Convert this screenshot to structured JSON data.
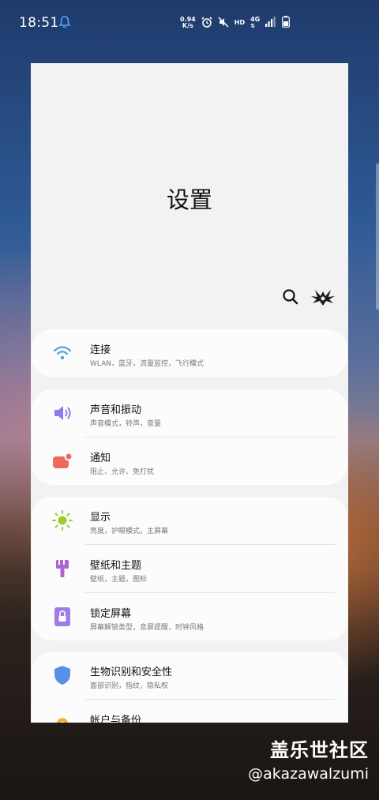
{
  "status": {
    "time": "18:51",
    "speed_value": "0.94",
    "speed_unit": "K/s",
    "hd": "HD",
    "net": "4G"
  },
  "settings": {
    "title": "设置",
    "groups": [
      {
        "items": [
          {
            "label": "连接",
            "sub": "WLAN，蓝牙，流量监控，飞行模式",
            "icon": "wifi-icon"
          }
        ]
      },
      {
        "items": [
          {
            "label": "声音和振动",
            "sub": "声音模式，铃声，音量",
            "icon": "speaker-icon"
          },
          {
            "label": "通知",
            "sub": "阻止、允许、免打扰",
            "icon": "notification-icon"
          }
        ]
      },
      {
        "items": [
          {
            "label": "显示",
            "sub": "亮度，护眼模式，主屏幕",
            "icon": "brightness-icon"
          },
          {
            "label": "壁纸和主题",
            "sub": "壁纸，主题，图标",
            "icon": "paint-brush-icon"
          },
          {
            "label": "锁定屏幕",
            "sub": "屏幕解锁类型，息屏提醒，时钟风格",
            "icon": "lock-icon"
          }
        ]
      },
      {
        "items": [
          {
            "label": "生物识别和安全性",
            "sub": "面部识别，指纹，隐私权",
            "icon": "shield-icon"
          },
          {
            "label": "帐户与备份",
            "sub": "",
            "icon": "key-icon"
          }
        ]
      }
    ]
  },
  "watermark": {
    "title": "盖乐世社区",
    "user": "@akazawalzumi"
  },
  "colors": {
    "wifi": "#4aa3df",
    "speaker": "#8e7cf0",
    "notification": "#ee6a5e",
    "brightness": "#9ccd2e",
    "brush": "#b063d6",
    "lock": "#a07de6",
    "shield": "#5a8fe8",
    "key": "#f2b330"
  }
}
